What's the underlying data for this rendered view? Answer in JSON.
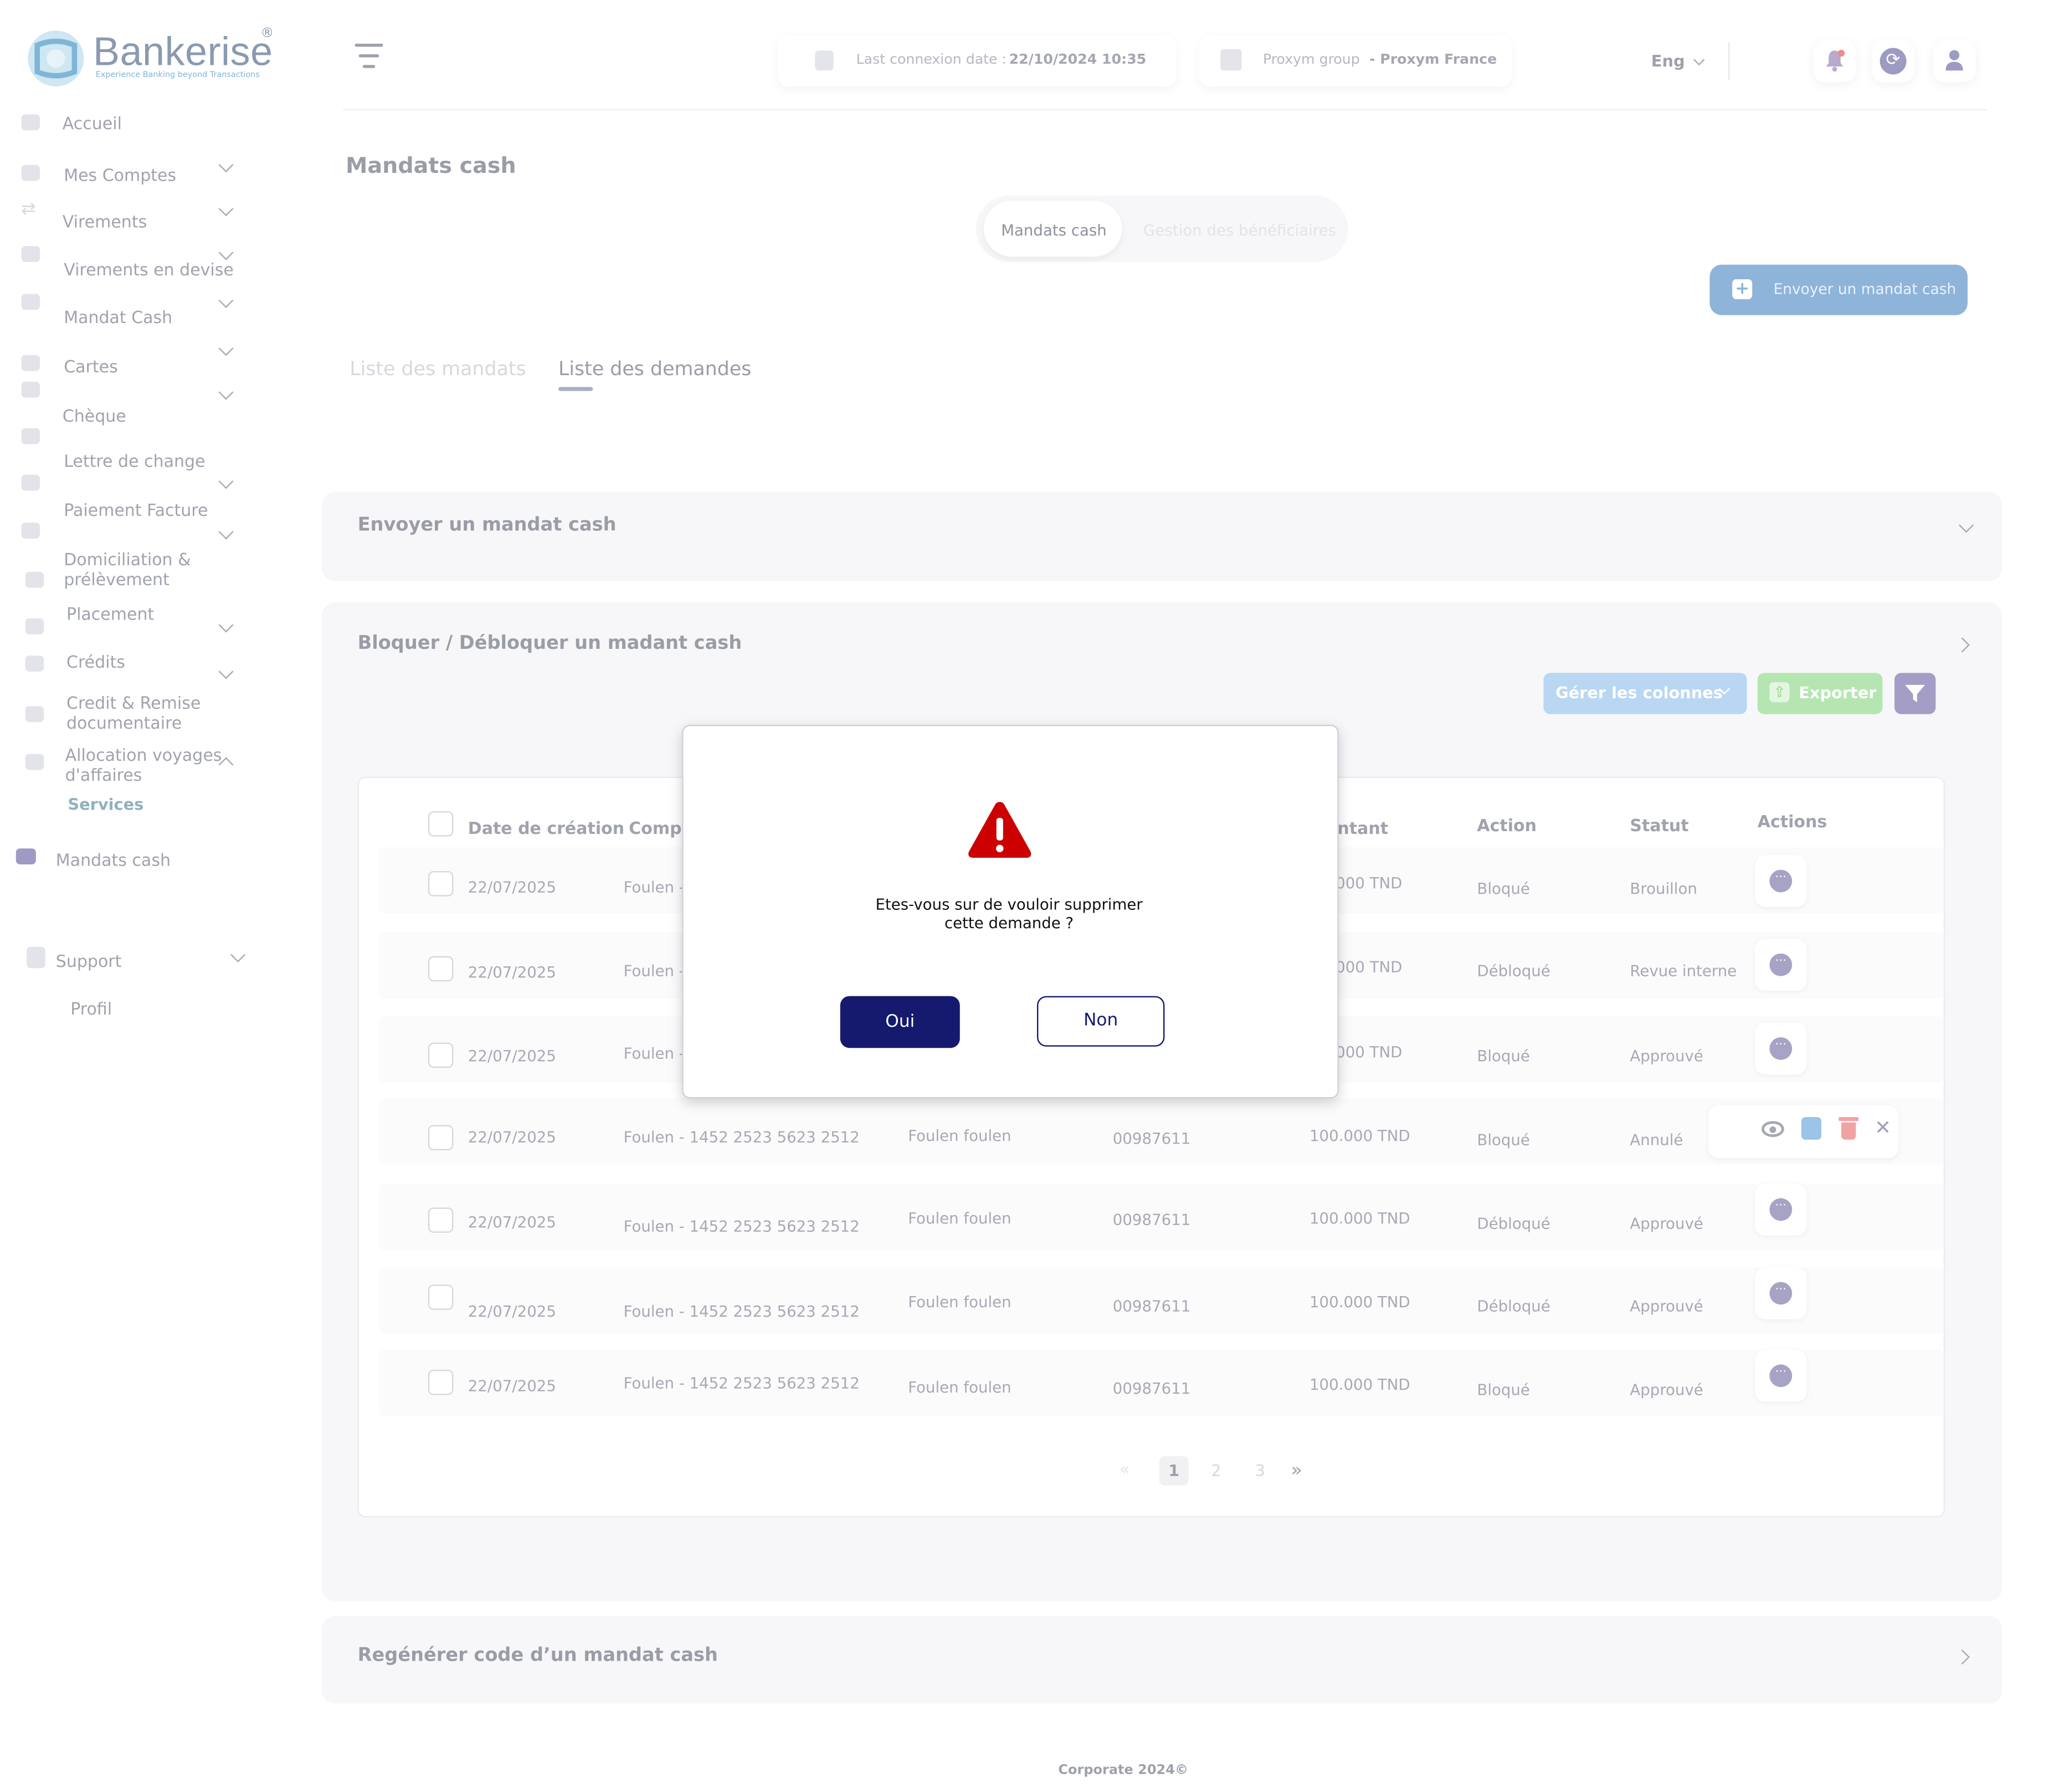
{
  "brand": {
    "name": "Bankerise",
    "tagline": "Experience Banking beyond Transactions",
    "registered": "®"
  },
  "sidebar": {
    "items": [
      {
        "label": "Accueil"
      },
      {
        "label": "Mes Comptes"
      },
      {
        "label": "Virements"
      },
      {
        "label": "Virements en devise"
      },
      {
        "label": "Mandat Cash"
      },
      {
        "label": "Cartes"
      },
      {
        "label": "Chèque"
      },
      {
        "label": "Lettre de change"
      },
      {
        "label": "Paiement Facture"
      },
      {
        "label": "Domiciliation &"
      },
      {
        "label": "prélèvement"
      },
      {
        "label": "Placement"
      },
      {
        "label": "Crédits"
      },
      {
        "label": "Credit & Remise"
      },
      {
        "label": "documentaire"
      },
      {
        "label": "Allocation  voyages"
      },
      {
        "label": "d'affaires"
      },
      {
        "label": "Services"
      },
      {
        "label": "Mandats cash"
      },
      {
        "label": "Support"
      },
      {
        "label": "Profil"
      }
    ]
  },
  "header": {
    "last_connexion_label": "Last connexion date :",
    "last_connexion_value": "22/10/2024 10:35",
    "group_label": "Proxym group",
    "group_value": "- Proxym France",
    "language": "Eng"
  },
  "page": {
    "title": "Mandats cash",
    "segments": [
      "Mandats cash",
      "Gestion des bénéficiaires"
    ],
    "send_button": "Envoyer un mandat cash",
    "tabs": [
      "Liste des mandats",
      "Liste des demandes"
    ]
  },
  "sections": {
    "send": "Envoyer un mandat cash",
    "block": "Bloquer / Débloquer un madant cash",
    "regen": "Regénérer code d’un mandat cash"
  },
  "toolbar": {
    "columns": "Gérer les colonnes",
    "export": "Exporter"
  },
  "table": {
    "headers": [
      "Date de création",
      "Compt",
      "ntant",
      "Action",
      "Statut",
      "Actions"
    ],
    "rows": [
      {
        "date": "22/07/2025",
        "compte": "Foulen -",
        "nom": "",
        "ref": "",
        "montant": ".000 TND",
        "action": "Bloqué",
        "statut": "Brouillon"
      },
      {
        "date": "22/07/2025",
        "compte": "Foulen -",
        "nom": "",
        "ref": "",
        "montant": ".000 TND",
        "action": "Débloqué",
        "statut": "Revue interne"
      },
      {
        "date": "22/07/2025",
        "compte": "Foulen -",
        "nom": "",
        "ref": "",
        "montant": ".000 TND",
        "action": "Bloqué",
        "statut": "Approuvé"
      },
      {
        "date": "22/07/2025",
        "compte": "Foulen - 1452 2523 5623 2512",
        "nom": "Foulen foulen",
        "ref": "00987611",
        "montant": "100.000 TND",
        "action": "Bloqué",
        "statut": "Annulé"
      },
      {
        "date": "22/07/2025",
        "compte": "Foulen - 1452 2523 5623 2512",
        "nom": "Foulen foulen",
        "ref": "00987611",
        "montant": "100.000 TND",
        "action": "Débloqué",
        "statut": "Approuvé"
      },
      {
        "date": "22/07/2025",
        "compte": "Foulen - 1452 2523 5623 2512",
        "nom": "Foulen foulen",
        "ref": "00987611",
        "montant": "100.000 TND",
        "action": "Débloqué",
        "statut": "Approuvé"
      },
      {
        "date": "22/07/2025",
        "compte": "Foulen - 1452 2523 5623 2512",
        "nom": "Foulen foulen",
        "ref": "00987611",
        "montant": "100.000 TND",
        "action": "Bloqué",
        "statut": "Approuvé"
      }
    ]
  },
  "pagination": {
    "prev": "«",
    "pages": [
      "1",
      "2",
      "3"
    ],
    "next": "»"
  },
  "modal": {
    "line1": "Etes-vous sur de vouloir  supprimer",
    "line2": "cette demande  ?",
    "yes": "Oui",
    "no": "Non"
  },
  "footer": "Corporate 2024©",
  "colors": {
    "primary_navy": "#151a6e",
    "accent_blue": "#8fb4da",
    "export_green": "#b5e6b2",
    "warning_red": "#cc0000"
  }
}
